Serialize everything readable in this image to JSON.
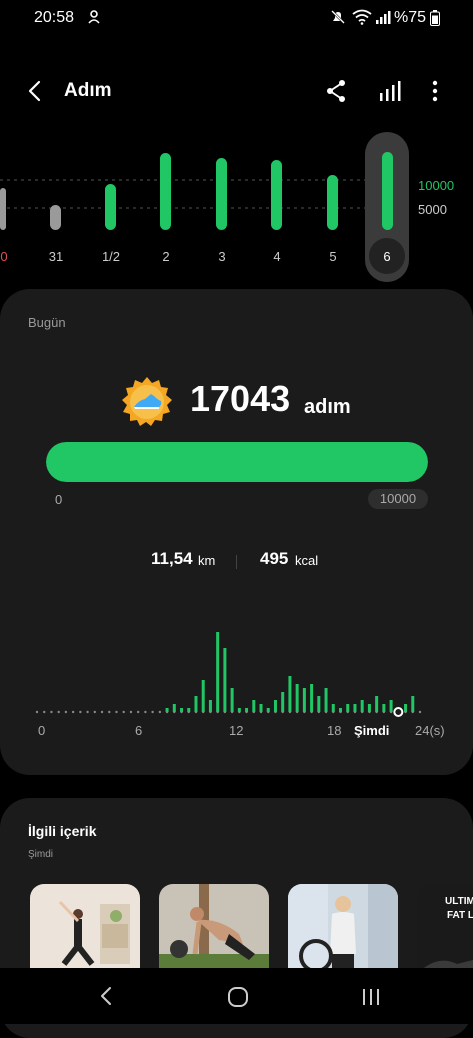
{
  "status": {
    "time": "20:58",
    "battery": "%75"
  },
  "header": {
    "title": "Adım",
    "back_icon": "back-arrow-icon",
    "share_icon": "share-icon",
    "chart_icon": "bar-chart-icon",
    "more_icon": "more-vert-icon"
  },
  "week_chart": {
    "labels": [
      "0",
      "31",
      "1/2",
      "2",
      "3",
      "4",
      "5",
      "6"
    ],
    "selected": "6",
    "axis": {
      "top": "10000",
      "mid": "5000"
    }
  },
  "today": {
    "label": "Bugün",
    "steps": "17043",
    "unit": "adım",
    "goal": "10000",
    "min": "0",
    "progress": 1.0,
    "distance": "11,54",
    "distance_unit": "km",
    "calories": "495",
    "calories_unit": "kcal",
    "medal_icon": "shoe-medal-icon"
  },
  "chart_data": {
    "type": "bar",
    "x_ticks": [
      "0",
      "6",
      "12",
      "18",
      "Şimdi",
      "24(s)"
    ],
    "note_unit": "hourly steps",
    "series": [
      {
        "values": [
          0,
          0,
          0,
          0,
          0,
          0,
          0,
          0,
          0,
          0,
          0,
          0,
          0,
          0,
          0,
          0,
          0,
          0,
          1,
          2,
          1,
          1,
          4,
          8,
          3,
          20,
          16,
          6,
          1,
          1,
          3,
          2,
          1,
          3,
          5,
          9,
          7,
          6,
          7,
          4,
          6,
          2,
          1,
          2,
          2,
          3,
          2,
          4,
          2,
          3,
          1,
          2,
          4,
          0
        ]
      }
    ]
  },
  "related": {
    "title": "İlgili içerik",
    "subtitle": "Şimdi",
    "thumb4_text_1": "ULTIM",
    "thumb4_text_2": "FAT L"
  },
  "nav": {
    "back_icon": "nav-back-icon",
    "home_icon": "nav-home-icon",
    "recents_icon": "nav-recents-icon"
  }
}
